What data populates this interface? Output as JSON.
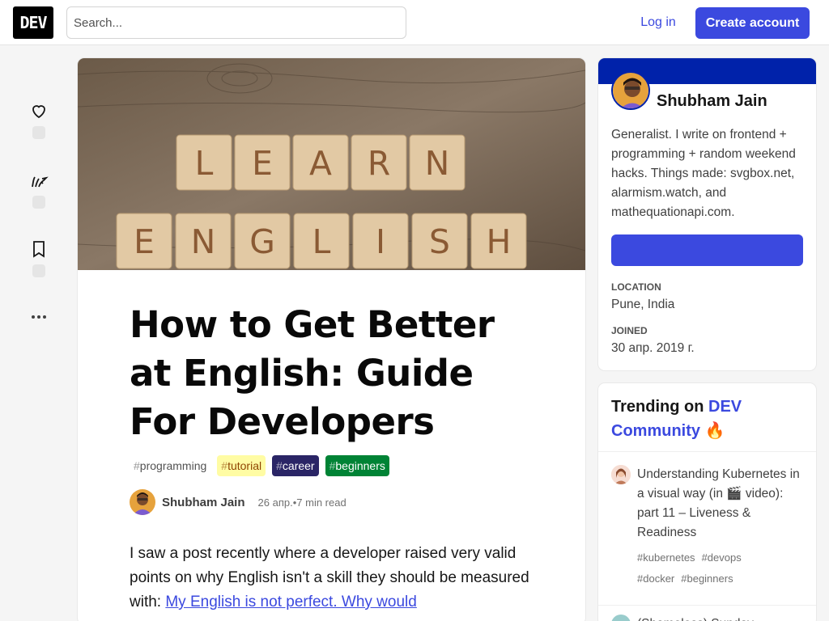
{
  "header": {
    "logo": "DEV",
    "search_placeholder": "Search...",
    "login_label": "Log in",
    "create_label": "Create account"
  },
  "reactions": [
    {
      "icon": "heart-icon"
    },
    {
      "icon": "unicorn-icon"
    },
    {
      "icon": "bookmark-icon"
    }
  ],
  "more_icon": "more-horizontal-icon",
  "article": {
    "cover_alt": "LEARN ENGLISH",
    "cover_words": [
      "LEARN",
      "ENGLISH"
    ],
    "title": "How to Get Better at English: Guide For Developers",
    "tags": [
      {
        "hash": "#",
        "name": "programming",
        "bg": "#ffffff",
        "color": "#525252"
      },
      {
        "hash": "#",
        "name": "tutorial",
        "bg": "#fffca4",
        "color": "#8f4400"
      },
      {
        "hash": "#",
        "name": "career",
        "bg": "#2a2566",
        "color": "#ffffff"
      },
      {
        "hash": "#",
        "name": "beginners",
        "bg": "#008335",
        "color": "#ffffff"
      }
    ],
    "author": "Shubham Jain",
    "date": "26 апр.",
    "dot": "•",
    "read_time": "7 min read",
    "body_prefix": "I saw a post recently where a developer raised very valid points on why English isn't a skill they should be measured with: ",
    "body_link": "My English is not perfect. Why would"
  },
  "profile": {
    "name": "Shubham Jain",
    "bio": "Generalist. I write on frontend + programming + random weekend hacks. Things made: svgbox.net, alarmism.watch, and mathequationapi.com.",
    "location_label": "LOCATION",
    "location": "Pune, India",
    "joined_label": "JOINED",
    "joined": "30 апр. 2019 г."
  },
  "trending": {
    "heading_prefix": "Trending on ",
    "heading_accent": "DEV Community",
    "heading_emoji": "🔥",
    "items": [
      {
        "title": "Understanding Kubernetes in a visual way (in 🎬 video): part 11 – Liveness & Readiness",
        "tags": [
          "#kubernetes",
          "#devops",
          "#docker",
          "#beginners"
        ]
      },
      {
        "title": "(Shameless) Sunday ..."
      }
    ]
  },
  "colors": {
    "accent": "#3b49df",
    "brand_band": "#0022aa"
  }
}
